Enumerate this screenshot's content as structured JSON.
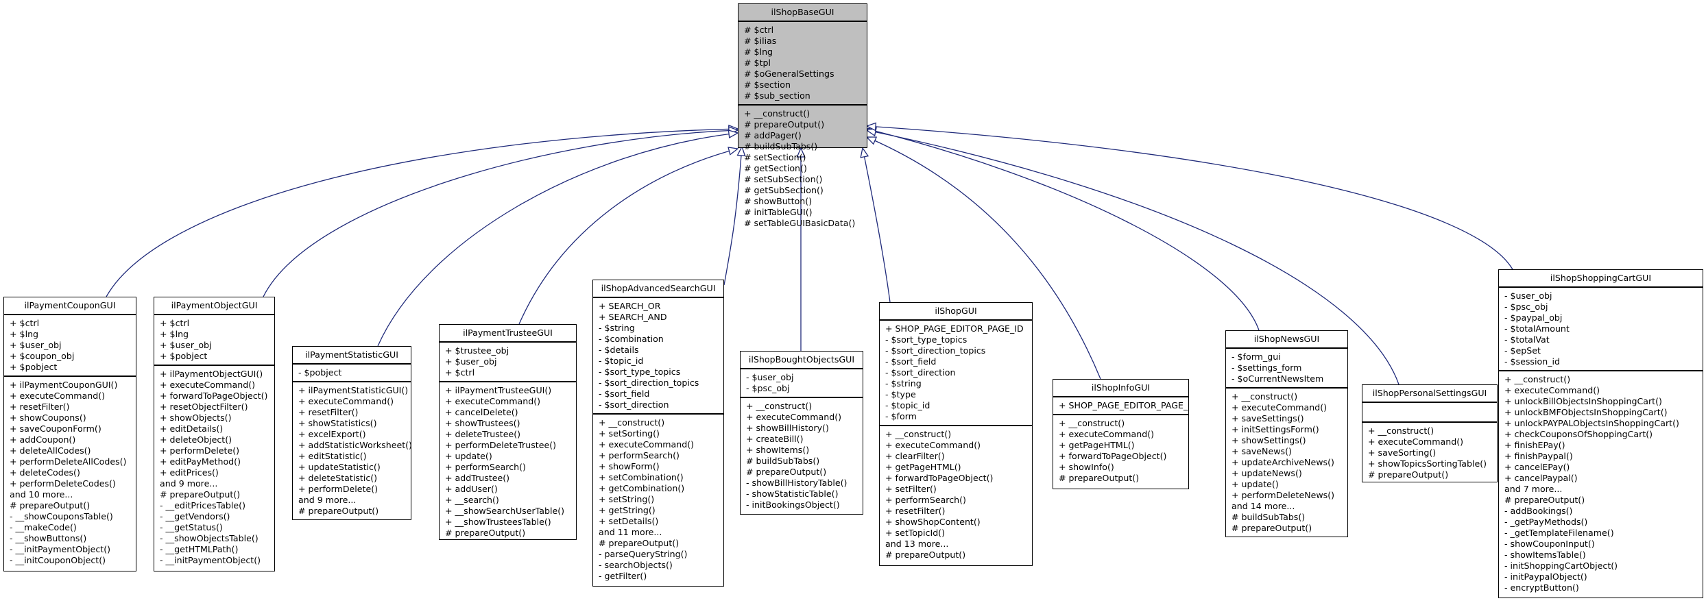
{
  "diagram": {
    "type": "class-inheritance",
    "edge_color": "#1f2a7a",
    "base_fill": "#bfbfbf",
    "base": {
      "name": "ilShopBaseGUI",
      "attributes": [
        "# $ctrl",
        "# $ilias",
        "# $lng",
        "# $tpl",
        "# $oGeneralSettings",
        "# $section",
        "# $sub_section"
      ],
      "operations": [
        "+ __construct()",
        "# prepareOutput()",
        "# addPager()",
        "# buildSubTabs()",
        "# setSection()",
        "# getSection()",
        "# setSubSection()",
        "# getSubSection()",
        "# showButton()",
        "# initTableGUI()",
        "# setTableGUIBasicData()"
      ]
    },
    "classes": [
      {
        "id": "ilPaymentCouponGUI",
        "name": "ilPaymentCouponGUI",
        "attributes": [
          "+ $ctrl",
          "+ $lng",
          "+ $user_obj",
          "+ $coupon_obj",
          "+ $pobject"
        ],
        "operations": [
          "+ ilPaymentCouponGUI()",
          "+ executeCommand()",
          "+ resetFilter()",
          "+ showCoupons()",
          "+ saveCouponForm()",
          "+ addCoupon()",
          "+ deleteAllCodes()",
          "+ performDeleteAllCodes()",
          "+ deleteCodes()",
          "+ performDeleteCodes()",
          "and 10 more...",
          "# prepareOutput()",
          "- __showCouponsTable()",
          "- __makeCode()",
          "- __showButtons()",
          "- __initPaymentObject()",
          "- __initCouponObject()"
        ]
      },
      {
        "id": "ilPaymentObjectGUI",
        "name": "ilPaymentObjectGUI",
        "attributes": [
          "+ $ctrl",
          "+ $lng",
          "+ $user_obj",
          "+ $pobject"
        ],
        "operations": [
          "+ ilPaymentObjectGUI()",
          "+ executeCommand()",
          "+ forwardToPageObject()",
          "+ resetObjectFilter()",
          "+ showObjects()",
          "+ editDetails()",
          "+ deleteObject()",
          "+ performDelete()",
          "+ editPayMethod()",
          "+ editPrices()",
          "and 9 more...",
          "# prepareOutput()",
          "- __editPricesTable()",
          "- __getVendors()",
          "- __getStatus()",
          "- __showObjectsTable()",
          "- __getHTMLPath()",
          "- __initPaymentObject()"
        ]
      },
      {
        "id": "ilPaymentStatisticGUI",
        "name": "ilPaymentStatisticGUI",
        "attributes": [
          "- $pobject"
        ],
        "operations": [
          "+ ilPaymentStatisticGUI()",
          "+ executeCommand()",
          "+ resetFilter()",
          "+ showStatistics()",
          "+ excelExport()",
          "+ addStatisticWorksheet()",
          "+ editStatistic()",
          "+ updateStatistic()",
          "+ deleteStatistic()",
          "+ performDelete()",
          "and 9 more...",
          "# prepareOutput()"
        ]
      },
      {
        "id": "ilPaymentTrusteeGUI",
        "name": "ilPaymentTrusteeGUI",
        "attributes": [
          "+ $trustee_obj",
          "+ $user_obj",
          "+ $ctrl"
        ],
        "operations": [
          "+ ilPaymentTrusteeGUI()",
          "+ executeCommand()",
          "+ cancelDelete()",
          "+ showTrustees()",
          "+ deleteTrustee()",
          "+ performDeleteTrustee()",
          "+ update()",
          "+ performSearch()",
          "+ addTrustee()",
          "+ addUser()",
          "+ __search()",
          "+ __showSearchUserTable()",
          "+ __showTrusteesTable()",
          "# prepareOutput()"
        ]
      },
      {
        "id": "ilShopAdvancedSearchGUI",
        "name": "ilShopAdvancedSearchGUI",
        "attributes": [
          "+ SEARCH_OR",
          "+ SEARCH_AND",
          "- $string",
          "- $combination",
          "- $details",
          "- $topic_id",
          "- $sort_type_topics",
          "- $sort_direction_topics",
          "- $sort_field",
          "- $sort_direction"
        ],
        "operations": [
          "+ __construct()",
          "+ setSorting()",
          "+ executeCommand()",
          "+ performSearch()",
          "+ showForm()",
          "+ setCombination()",
          "+ getCombination()",
          "+ setString()",
          "+ getString()",
          "+ setDetails()",
          "and 11 more...",
          "# prepareOutput()",
          "- parseQueryString()",
          "- searchObjects()",
          "- getFilter()"
        ]
      },
      {
        "id": "ilShopBoughtObjectsGUI",
        "name": "ilShopBoughtObjectsGUI",
        "attributes": [
          "- $user_obj",
          "- $psc_obj"
        ],
        "operations": [
          "+ __construct()",
          "+ executeCommand()",
          "+ showBillHistory()",
          "+ createBill()",
          "+ showItems()",
          "# buildSubTabs()",
          "# prepareOutput()",
          "- showBillHistoryTable()",
          "- showStatisticTable()",
          "- initBookingsObject()"
        ]
      },
      {
        "id": "ilShopGUI",
        "name": "ilShopGUI",
        "attributes": [
          "+ SHOP_PAGE_EDITOR_PAGE_ID",
          "- $sort_type_topics",
          "- $sort_direction_topics",
          "- $sort_field",
          "- $sort_direction",
          "- $string",
          "- $type",
          "- $topic_id",
          "- $form"
        ],
        "operations": [
          "+ __construct()",
          "+ executeCommand()",
          "+ clearFilter()",
          "+ getPageHTML()",
          "+ forwardToPageObject()",
          "+ setFilter()",
          "+ performSearch()",
          "+ resetFilter()",
          "+ showShopContent()",
          "+ setTopicId()",
          "and 13 more...",
          "# prepareOutput()"
        ]
      },
      {
        "id": "ilShopInfoGUI",
        "name": "ilShopInfoGUI",
        "attributes": [
          "+ SHOP_PAGE_EDITOR_PAGE_ID"
        ],
        "operations": [
          "+ __construct()",
          "+ executeCommand()",
          "+ getPageHTML()",
          "+ forwardToPageObject()",
          "+ showInfo()",
          "# prepareOutput()"
        ]
      },
      {
        "id": "ilShopNewsGUI",
        "name": "ilShopNewsGUI",
        "attributes": [
          "- $form_gui",
          "- $settings_form",
          "- $oCurrentNewsItem"
        ],
        "operations": [
          "+ __construct()",
          "+ executeCommand()",
          "+ saveSettings()",
          "+ initSettingsForm()",
          "+ showSettings()",
          "+ saveNews()",
          "+ updateArchiveNews()",
          "+ updateNews()",
          "+ update()",
          "+ performDeleteNews()",
          "and 14 more...",
          "# buildSubTabs()",
          "# prepareOutput()"
        ]
      },
      {
        "id": "ilShopPersonalSettingsGUI",
        "name": "ilShopPersonalSettingsGUI",
        "attributes": [],
        "operations": [
          "+ __construct()",
          "+ executeCommand()",
          "+ saveSorting()",
          "+ showTopicsSortingTable()",
          "# prepareOutput()"
        ]
      },
      {
        "id": "ilShopShoppingCartGUI",
        "name": "ilShopShoppingCartGUI",
        "attributes": [
          "- $user_obj",
          "- $psc_obj",
          "- $paypal_obj",
          "- $totalAmount",
          "- $totalVat",
          "- $epSet",
          "- $session_id"
        ],
        "operations": [
          "+ __construct()",
          "+ executeCommand()",
          "+ unlockBillObjectsInShoppingCart()",
          "+ unlockBMFObjectsInShoppingCart()",
          "+ unlockPAYPALObjectsInShoppingCart()",
          "+ checkCouponsOfShoppingCart()",
          "+ finishEPay()",
          "+ finishPaypal()",
          "+ cancelEPay()",
          "+ cancelPaypal()",
          "and 7 more...",
          "# prepareOutput()",
          "- addBookings()",
          "- _getPayMethods()",
          "- _getTemplateFilename()",
          "- showCouponInput()",
          "- showItemsTable()",
          "- initShoppingCartObject()",
          "- initPaypalObject()",
          "- encryptButton()"
        ]
      }
    ]
  }
}
